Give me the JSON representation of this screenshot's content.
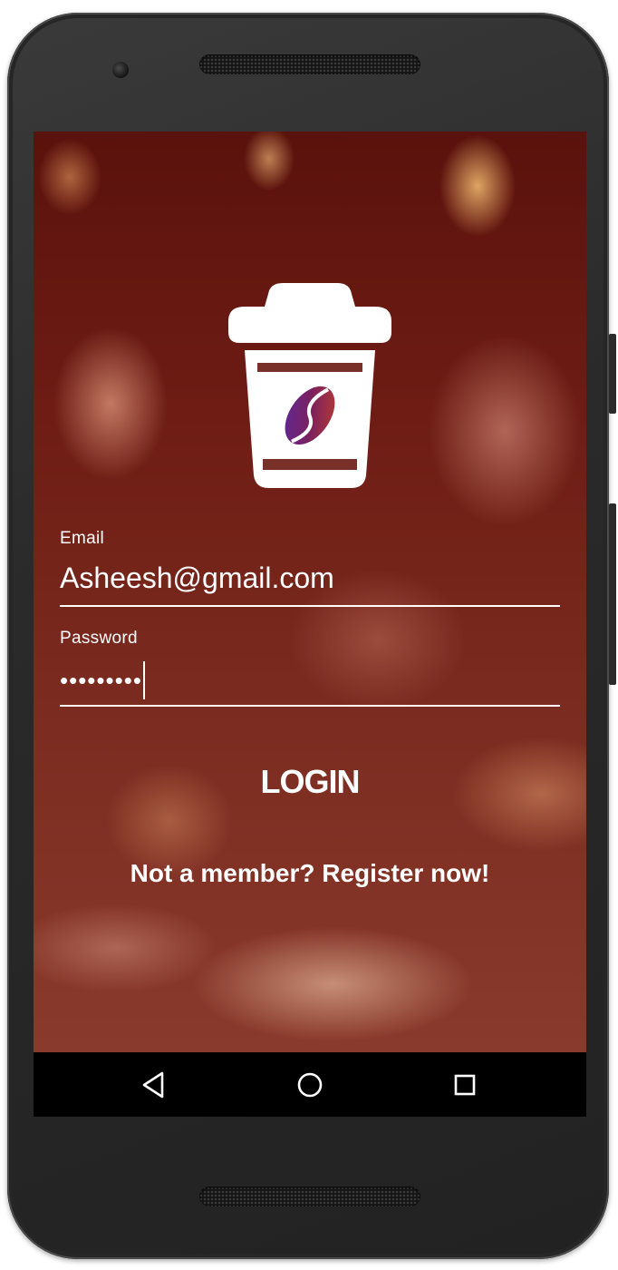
{
  "login_form": {
    "email": {
      "label": "Email",
      "value": "Asheesh@gmail.com"
    },
    "password": {
      "label": "Password",
      "value": "•••••••••"
    },
    "login_label": "LOGIN",
    "register_link": "Not a member? Register now!"
  },
  "icons": {
    "logo": "coffee-cup-icon",
    "nav_back": "triangle-back-icon",
    "nav_home": "circle-home-icon",
    "nav_recents": "square-recents-icon"
  },
  "colors": {
    "overlay": "#7a1a12",
    "text": "#ffffff",
    "navbar": "#000000",
    "device_frame": "#2e2e2e"
  }
}
